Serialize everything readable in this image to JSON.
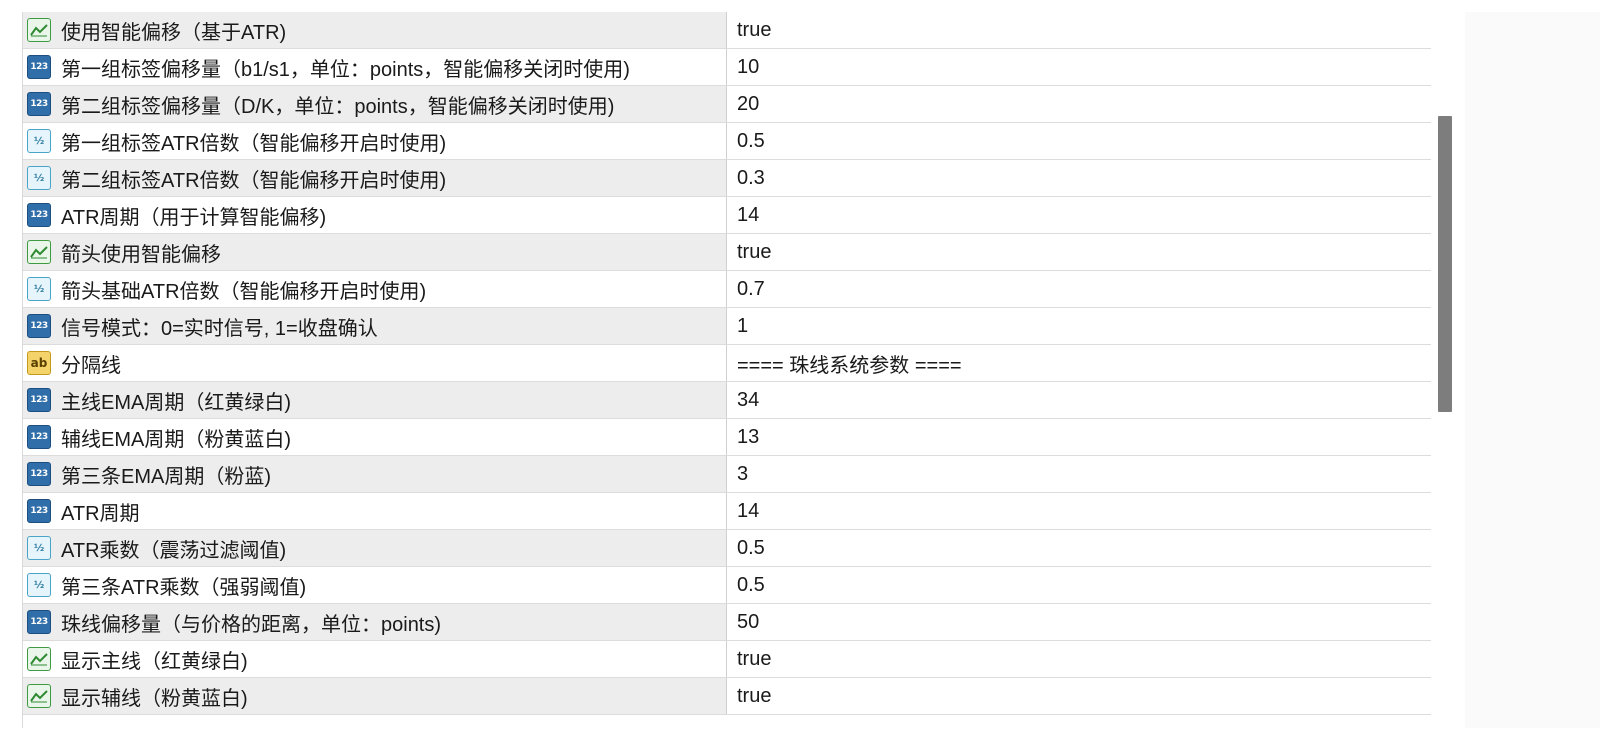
{
  "params": [
    {
      "icon": "bool-icon",
      "name": "使用智能偏移（基于ATR)",
      "value": "true"
    },
    {
      "icon": "int-icon",
      "name": "第一组标签偏移量（b1/s1，单位：points，智能偏移关闭时使用)",
      "value": "10"
    },
    {
      "icon": "int-icon",
      "name": "第二组标签偏移量（D/K，单位：points，智能偏移关闭时使用)",
      "value": "20"
    },
    {
      "icon": "double-icon",
      "name": "第一组标签ATR倍数（智能偏移开启时使用)",
      "value": "0.5"
    },
    {
      "icon": "double-icon",
      "name": "第二组标签ATR倍数（智能偏移开启时使用)",
      "value": "0.3"
    },
    {
      "icon": "int-icon",
      "name": "ATR周期（用于计算智能偏移)",
      "value": "14"
    },
    {
      "icon": "bool-icon",
      "name": "箭头使用智能偏移",
      "value": "true"
    },
    {
      "icon": "double-icon",
      "name": "箭头基础ATR倍数（智能偏移开启时使用)",
      "value": "0.7"
    },
    {
      "icon": "int-icon",
      "name": "信号模式：0=实时信号, 1=收盘确认",
      "value": "1"
    },
    {
      "icon": "string-icon",
      "name": "分隔线",
      "value": "==== 珠线系统参数 ===="
    },
    {
      "icon": "int-icon",
      "name": "主线EMA周期（红黄绿白)",
      "value": "34"
    },
    {
      "icon": "int-icon",
      "name": "辅线EMA周期（粉黄蓝白)",
      "value": "13"
    },
    {
      "icon": "int-icon",
      "name": "第三条EMA周期（粉蓝)",
      "value": "3"
    },
    {
      "icon": "int-icon",
      "name": "ATR周期",
      "value": "14"
    },
    {
      "icon": "double-icon",
      "name": "ATR乘数（震荡过滤阈值)",
      "value": "0.5"
    },
    {
      "icon": "double-icon",
      "name": "第三条ATR乘数（强弱阈值)",
      "value": "0.5"
    },
    {
      "icon": "int-icon",
      "name": "珠线偏移量（与价格的距离，单位：points)",
      "value": "50"
    },
    {
      "icon": "bool-icon",
      "name": "显示主线（红黄绿白)",
      "value": "true"
    },
    {
      "icon": "bool-icon",
      "name": "显示辅线（粉黄蓝白)",
      "value": "true"
    }
  ],
  "icon_glyphs": {
    "int-icon": "123",
    "double-icon": "½",
    "string-icon": "ab"
  }
}
